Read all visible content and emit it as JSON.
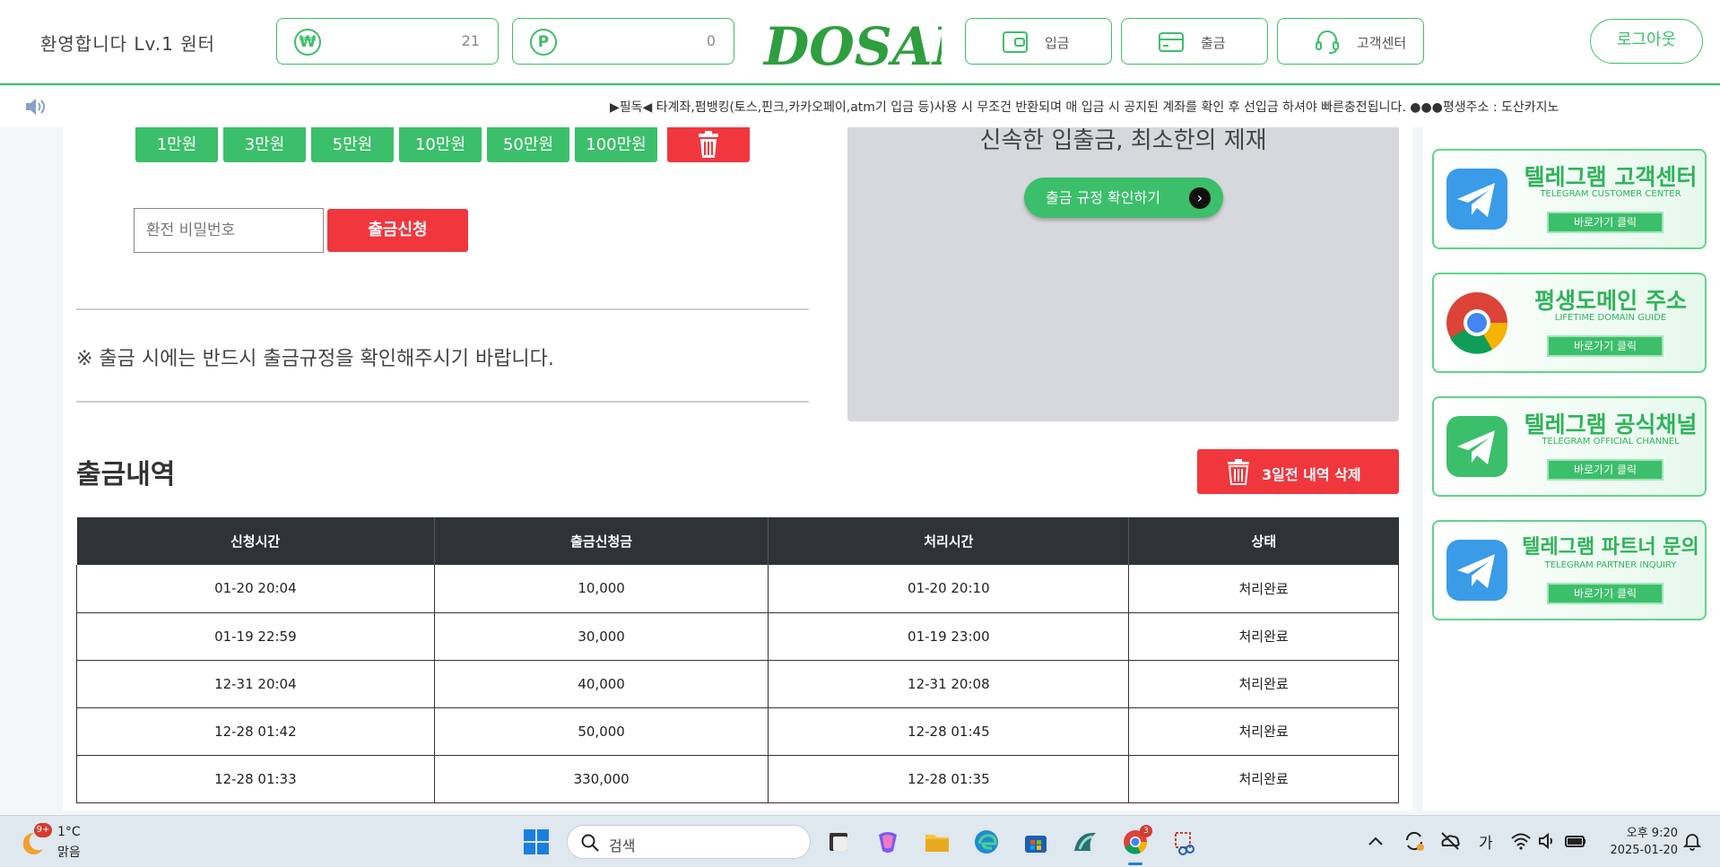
{
  "header": {
    "welcome": "환영합니다  Lv.1  원터",
    "money": {
      "symbol": "₩",
      "value": "21"
    },
    "point": {
      "symbol": "P",
      "value": "0"
    },
    "logo_text": "DOSAN",
    "deposit_label": "입금",
    "withdraw_label": "출금",
    "support_label": "고객센터",
    "logout_label": "로그아웃"
  },
  "notice": {
    "text": "▶필독◀ 타계좌,펌뱅킹(토스,핀크,카카오페이,atm기 입금 등)사용 시 무조건 반환되며 매 입금 시 공지된 계좌를 확인 후 선입금 하셔야 빠른충전됩니다. ●●●평생주소 : 도산카지노"
  },
  "withdraw": {
    "amounts": [
      "1만원",
      "3만원",
      "5만원",
      "10만원",
      "50만원",
      "100만원"
    ],
    "password_placeholder": "환전 비밀번호",
    "apply_label": "출금신청",
    "rule_note": "※ 출금 시에는 반드시 출금규정을 확인해주시기 바랍니다.",
    "promo_title": "신속한 입출금, 최소한의 제재",
    "promo_button": "출금 규정 확인하기"
  },
  "history": {
    "title": "출금내역",
    "delete_label": "3일전 내역 삭제",
    "columns": [
      "신청시간",
      "출금신청금",
      "처리시간",
      "상태"
    ],
    "rows": [
      [
        "01-20 20:04",
        "10,000",
        "01-20 20:10",
        "처리완료"
      ],
      [
        "01-19 22:59",
        "30,000",
        "01-19 23:00",
        "처리완료"
      ],
      [
        "12-31 20:04",
        "40,000",
        "12-31 20:08",
        "처리완료"
      ],
      [
        "12-28 01:42",
        "50,000",
        "12-28 01:45",
        "처리완료"
      ],
      [
        "12-28 01:33",
        "330,000",
        "12-28 01:35",
        "처리완료"
      ]
    ]
  },
  "sidebar": {
    "banners": [
      {
        "title": "텔레그램 고객센터",
        "sub": "TELEGRAM CUSTOMER CENTER",
        "button": "바로가기 클릭",
        "icon": "telegram-icon"
      },
      {
        "title": "평생도메인 주소",
        "sub": "LIFETIME DOMAIN GUIDE",
        "button": "바로가기 클릭",
        "icon": "chrome-icon"
      },
      {
        "title": "텔레그램 공식채널",
        "sub": "TELEGRAM OFFICIAL CHANNEL",
        "button": "바로가기 클릭",
        "icon": "telegram-icon"
      },
      {
        "title": "텔레그램 파트너 문의",
        "sub": "TELEGRAM PARTNER INQUIRY",
        "button": "바로가기 클릭",
        "icon": "telegram-icon"
      }
    ]
  },
  "taskbar": {
    "weather_badge": "9+",
    "temperature": "1°C",
    "condition": "맑음",
    "search_label": "검색",
    "chrome_badge": "3",
    "ime": "가",
    "time": "오후 9:20",
    "date": "2025-01-20"
  },
  "colors": {
    "accent": "#3cbf6a",
    "danger": "#f0373e",
    "table_header": "#2f3338"
  }
}
